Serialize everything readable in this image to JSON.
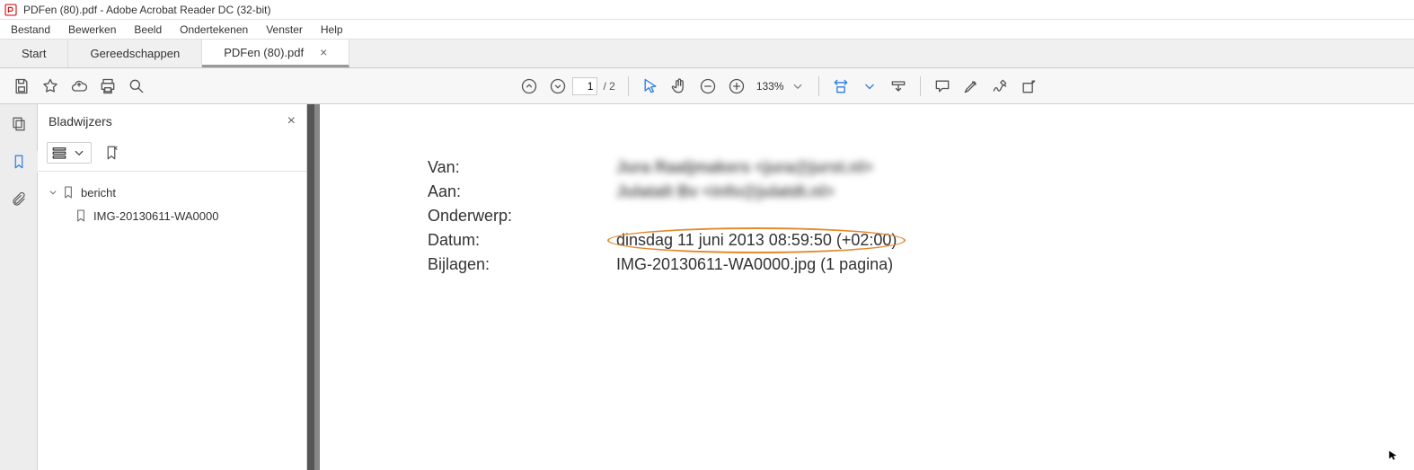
{
  "window": {
    "title": "PDFen (80).pdf - Adobe Acrobat Reader DC (32-bit)"
  },
  "menu": {
    "items": [
      "Bestand",
      "Bewerken",
      "Beeld",
      "Ondertekenen",
      "Venster",
      "Help"
    ]
  },
  "tabs": {
    "start": "Start",
    "tools": "Gereedschappen",
    "file": "PDFen (80).pdf"
  },
  "toolbar": {
    "page_current": "1",
    "page_total": "/ 2",
    "zoom": "133%"
  },
  "bookmarks": {
    "title": "Bladwijzers",
    "root": "bericht",
    "child": "IMG-20130611-WA0000"
  },
  "document": {
    "labels": {
      "from": "Van:",
      "to": "Aan:",
      "subject": "Onderwerp:",
      "date": "Datum:",
      "attachments": "Bijlagen:"
    },
    "from_redacted": "Jura Raaljmakers <jura@jurst.nl>",
    "to_redacted": "Julatalt Bv <info@julatdt.nl>",
    "date": "dinsdag 11 juni 2013 08:59:50 (+02:00)",
    "attachments": "IMG-20130611-WA0000.jpg (1 pagina)"
  }
}
